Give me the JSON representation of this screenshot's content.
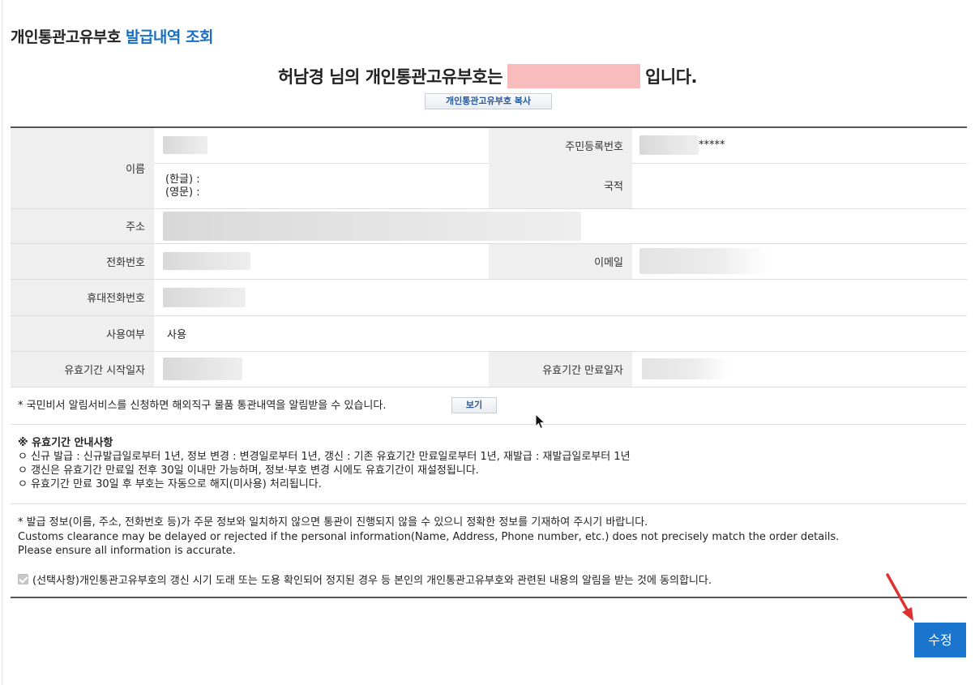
{
  "page": {
    "title_prefix": "개인통관고유부호",
    "title_accent": "발급내역 조회"
  },
  "headline": {
    "before": "허남경 님의 개인통관고유부호는",
    "after": "입니다."
  },
  "copy_button_label": "개인통관고유부호 복사",
  "info": {
    "name_label": "이름",
    "name_korean_label": "(한글) :",
    "name_english_label": "(영문) :",
    "rrn_label": "주민등록번호",
    "rrn_suffix": "*****",
    "nationality_label": "국적",
    "address_label": "주소",
    "phone_label": "전화번호",
    "email_label": "이메일",
    "mobile_label": "휴대전화번호",
    "usage_label": "사용여부",
    "usage_value": "사용",
    "valid_start_label": "유효기간 시작일자",
    "valid_end_label": "유효기간 만료일자"
  },
  "notice": {
    "text": "* 국민비서 알림서비스를 신청하면 해외직구 물품 통관내역을 알림받을 수 있습니다.",
    "view_button": "보기"
  },
  "guide": {
    "title": "※ 유효기간 안내사항",
    "items": [
      "ㅇ 신규 발급 : 신규발급일로부터 1년, 정보 변경 : 변경일로부터 1년, 갱신 : 기존 유효기간 만료일로부터 1년, 재발급 : 재발급일로부터 1년",
      "ㅇ 갱신은 유효기간 만료일 전후 30일 이내만 가능하며, 정보·부호 변경 시에도 유효기간이 재설정됩니다.",
      "ㅇ 유효기간 만료 30일 후 부호는 자동으로 해지(미사용) 처리됩니다."
    ]
  },
  "warning": {
    "line1": "* 발급 정보(이름, 주소, 전화번호 등)가 주문 정보와 일치하지 않으면 통관이 진행되지 않을 수 있으니 정확한 정보를 기재하여 주시기 바랍니다.",
    "line2": "Customs clearance may be delayed or rejected if the personal information(Name, Address, Phone number, etc.) does not precisely match the order details.",
    "line3": "Please ensure all information is accurate."
  },
  "consent": {
    "text": "(선택사항)개인통관고유부호의 갱신 시기 도래 또는 도용 확인되어 정지된 경우 등 본인의 개인통관고유부호와 관련된 내용의 알림을 받는 것에 동의합니다.",
    "checked": true
  },
  "edit_button": "수정",
  "colors": {
    "accent": "#1a6fc4",
    "button_primary": "#1a75cf",
    "masked_highlight": "#f9bcbc",
    "annotation_arrow": "#e03030"
  }
}
